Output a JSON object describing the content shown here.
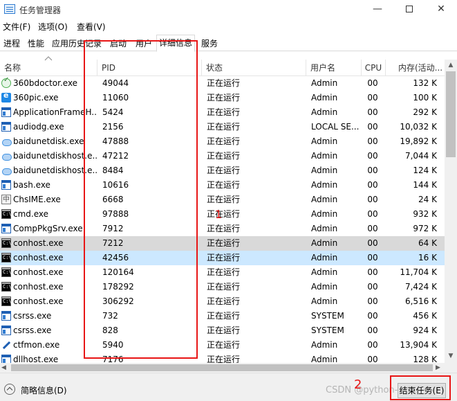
{
  "window": {
    "title": "任务管理器",
    "minimize_glyph": "—",
    "close_glyph": "✕"
  },
  "menu": [
    "文件(F)",
    "选项(O)",
    "查看(V)"
  ],
  "tabs": [
    {
      "label": "进程",
      "active": false
    },
    {
      "label": "性能",
      "active": false
    },
    {
      "label": "应用历史记录",
      "active": false
    },
    {
      "label": "启动",
      "active": false
    },
    {
      "label": "用户",
      "active": false
    },
    {
      "label": "详细信息",
      "active": true
    },
    {
      "label": "服务",
      "active": false
    }
  ],
  "columns": {
    "name": "名称",
    "pid": "PID",
    "status": "状态",
    "user": "用户名",
    "cpu": "CPU",
    "memory": "内存(活动..."
  },
  "rows": [
    {
      "name": "360bdoctor.exe",
      "pid": "49044",
      "status": "正在运行",
      "user": "Admin",
      "cpu": "00",
      "memory": "132 K",
      "icon": "shield-icon"
    },
    {
      "name": "360pic.exe",
      "pid": "11060",
      "status": "正在运行",
      "user": "Admin",
      "cpu": "00",
      "memory": "100 K",
      "icon": "picture-app-icon"
    },
    {
      "name": "ApplicationFrameH...",
      "pid": "5424",
      "status": "正在运行",
      "user": "Admin",
      "cpu": "00",
      "memory": "292 K",
      "icon": "window-app-icon"
    },
    {
      "name": "audiodg.exe",
      "pid": "2156",
      "status": "正在运行",
      "user": "LOCAL SE...",
      "cpu": "00",
      "memory": "10,032 K",
      "icon": "window-app-icon"
    },
    {
      "name": "baidunetdisk.exe",
      "pid": "47888",
      "status": "正在运行",
      "user": "Admin",
      "cpu": "00",
      "memory": "19,892 K",
      "icon": "cloud-icon"
    },
    {
      "name": "baidunetdiskhost.e...",
      "pid": "47212",
      "status": "正在运行",
      "user": "Admin",
      "cpu": "00",
      "memory": "7,044 K",
      "icon": "cloud-icon"
    },
    {
      "name": "baidunetdiskhost.e...",
      "pid": "8484",
      "status": "正在运行",
      "user": "Admin",
      "cpu": "00",
      "memory": "124 K",
      "icon": "cloud-icon"
    },
    {
      "name": "bash.exe",
      "pid": "10616",
      "status": "正在运行",
      "user": "Admin",
      "cpu": "00",
      "memory": "144 K",
      "icon": "window-app-icon"
    },
    {
      "name": "ChsIME.exe",
      "pid": "6668",
      "status": "正在运行",
      "user": "Admin",
      "cpu": "00",
      "memory": "24 K",
      "icon": "ime-icon"
    },
    {
      "name": "cmd.exe",
      "pid": "97888",
      "status": "正在运行",
      "user": "Admin",
      "cpu": "00",
      "memory": "932 K",
      "icon": "console-icon"
    },
    {
      "name": "CompPkgSrv.exe",
      "pid": "7912",
      "status": "正在运行",
      "user": "Admin",
      "cpu": "00",
      "memory": "972 K",
      "icon": "window-app-icon"
    },
    {
      "name": "conhost.exe",
      "pid": "7212",
      "status": "正在运行",
      "user": "Admin",
      "cpu": "00",
      "memory": "64 K",
      "icon": "console-icon",
      "highlight": "gray"
    },
    {
      "name": "conhost.exe",
      "pid": "42456",
      "status": "正在运行",
      "user": "Admin",
      "cpu": "00",
      "memory": "16 K",
      "icon": "console-icon",
      "highlight": "blue"
    },
    {
      "name": "conhost.exe",
      "pid": "120164",
      "status": "正在运行",
      "user": "Admin",
      "cpu": "00",
      "memory": "11,704 K",
      "icon": "console-icon"
    },
    {
      "name": "conhost.exe",
      "pid": "178292",
      "status": "正在运行",
      "user": "Admin",
      "cpu": "00",
      "memory": "7,424 K",
      "icon": "console-icon"
    },
    {
      "name": "conhost.exe",
      "pid": "306292",
      "status": "正在运行",
      "user": "Admin",
      "cpu": "00",
      "memory": "6,516 K",
      "icon": "console-icon"
    },
    {
      "name": "csrss.exe",
      "pid": "732",
      "status": "正在运行",
      "user": "SYSTEM",
      "cpu": "00",
      "memory": "456 K",
      "icon": "window-app-icon"
    },
    {
      "name": "csrss.exe",
      "pid": "828",
      "status": "正在运行",
      "user": "SYSTEM",
      "cpu": "00",
      "memory": "924 K",
      "icon": "window-app-icon"
    },
    {
      "name": "ctfmon.exe",
      "pid": "5940",
      "status": "正在运行",
      "user": "Admin",
      "cpu": "00",
      "memory": "13,904 K",
      "icon": "pen-icon"
    },
    {
      "name": "dllhost.exe",
      "pid": "7176",
      "status": "正在运行",
      "user": "Admin",
      "cpu": "00",
      "memory": "128 K",
      "icon": "window-app-icon"
    }
  ],
  "footer": {
    "fewer_details": "简略信息(D)",
    "end_task": "结束任务(E)",
    "watermark": "CSDN @python-小白"
  },
  "annotations": {
    "label1": "1",
    "label2": "2",
    "color": "#e81515"
  }
}
